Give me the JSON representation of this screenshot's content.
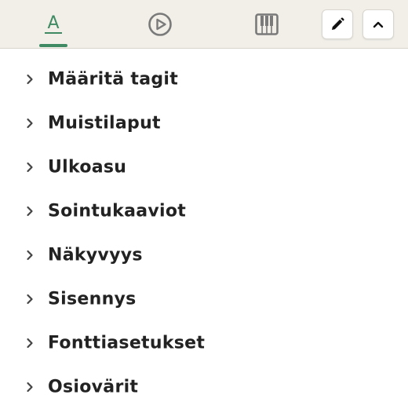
{
  "toolbar": {
    "tabs": [
      {
        "icon": "text-format-icon",
        "active": true
      },
      {
        "icon": "play-circle-icon",
        "active": false
      },
      {
        "icon": "piano-icon",
        "active": false
      }
    ],
    "buttons": [
      {
        "icon": "pencil-icon"
      },
      {
        "icon": "chevron-up-icon"
      }
    ],
    "tab_icon_text": "A",
    "colors": {
      "accent": "#3f8a62",
      "icon": "#7a7a7a",
      "toolbar_bg": "#f1efe8"
    }
  },
  "sections": [
    {
      "label": "Määritä tagit"
    },
    {
      "label": "Muistilaput"
    },
    {
      "label": "Ulkoasu"
    },
    {
      "label": "Sointukaaviot"
    },
    {
      "label": "Näkyvyys"
    },
    {
      "label": "Sisennys"
    },
    {
      "label": "Fonttiasetukset"
    },
    {
      "label": "Osiovärit"
    }
  ]
}
